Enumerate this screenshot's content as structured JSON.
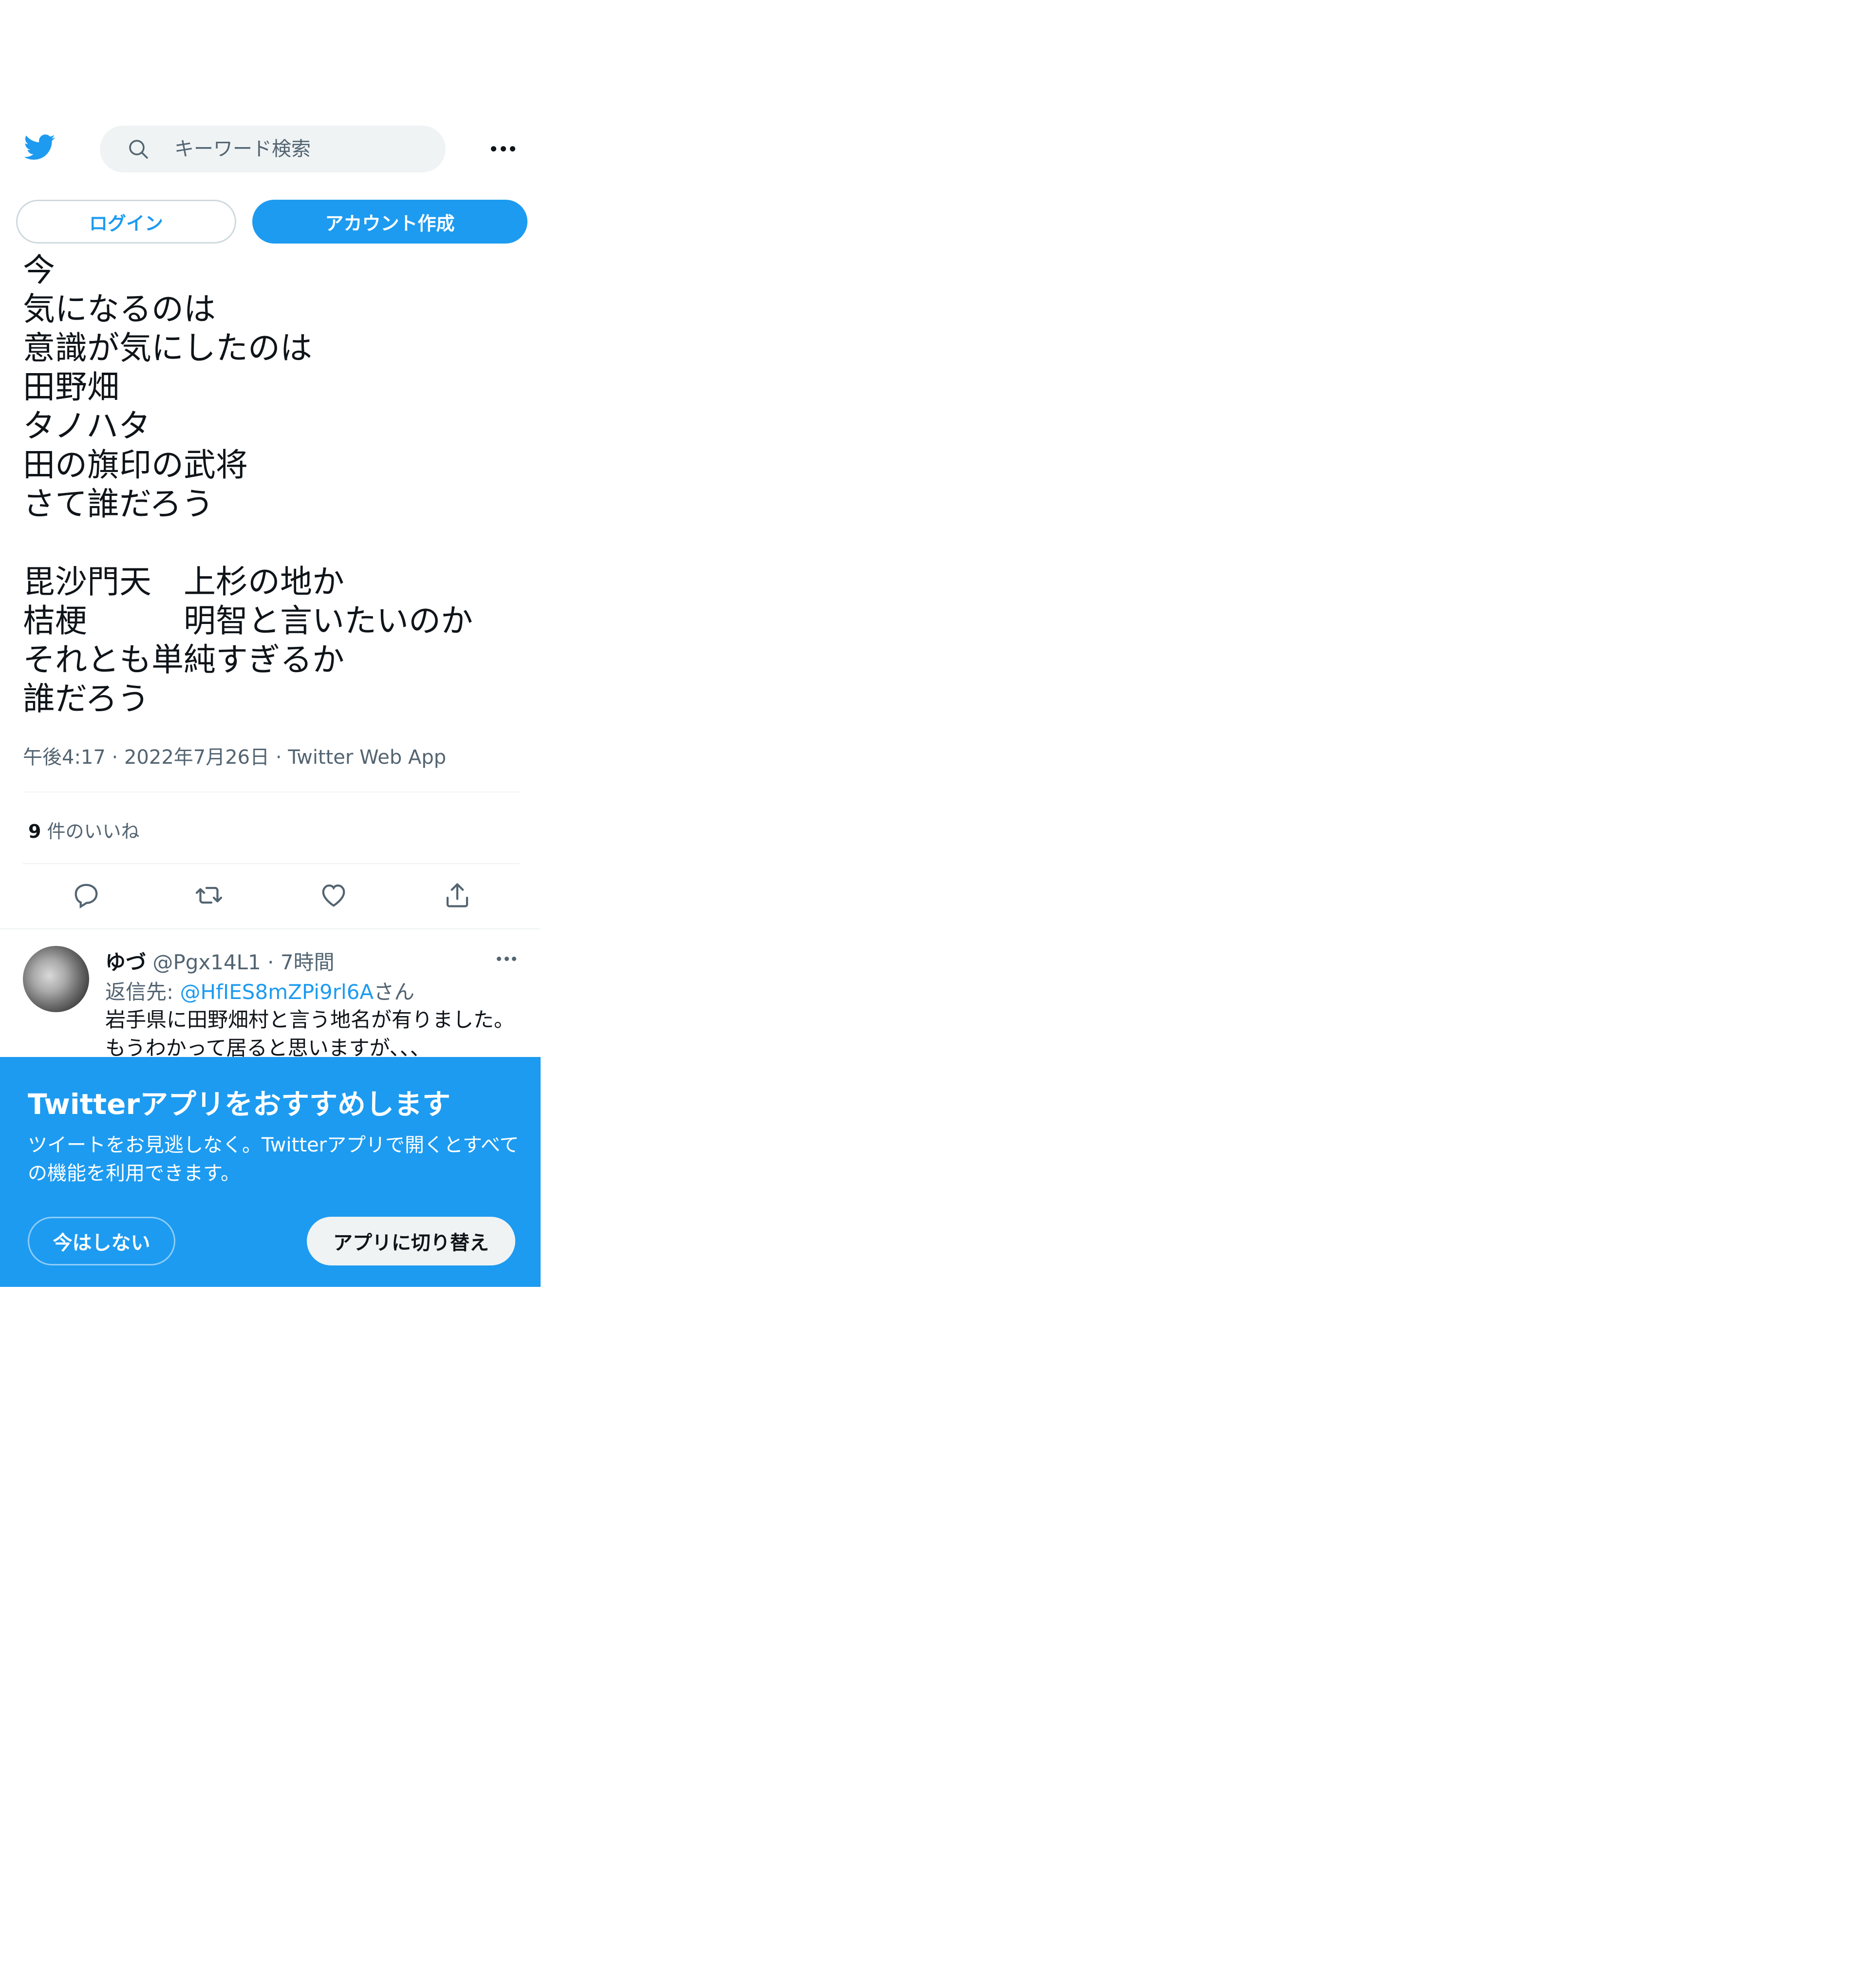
{
  "header": {
    "logo_icon": "twitter-bird-icon",
    "search": {
      "placeholder": "キーワード検索",
      "icon": "search-icon"
    },
    "more_icon": "more-horizontal-icon"
  },
  "auth": {
    "login_label": "ログイン",
    "signup_label": "アカウント作成"
  },
  "tweet": {
    "lines": [
      "今",
      "気になるのは",
      "意識が気にしたのは",
      "田野畑",
      "タノハタ",
      "田の旗印の武将",
      "さて誰だろう",
      "",
      "毘沙門天　上杉の地か",
      "桔梗　　　明智と言いたいのか",
      "それとも単純すぎるか",
      "誰だろう"
    ],
    "time": "午後4:17",
    "date": "2022年7月26日",
    "source": "Twitter Web App",
    "likes_count": "9",
    "likes_label": "件のいいね",
    "action_icons": [
      "reply-icon",
      "retweet-icon",
      "like-icon",
      "share-icon"
    ]
  },
  "reply": {
    "name": "ゆづ",
    "handle": "@Pgx14L1",
    "time": "7時間",
    "reply_to_prefix": "返信先: ",
    "reply_to_mention": "@HfIES8mZPi9rl6A",
    "reply_to_suffix": "さん",
    "text_line1": "岩手県に田野畑村と言う地名が有りました。",
    "text_line2": "もうわかって居ると思いますが、、、"
  },
  "app_promo": {
    "title": "Twitterアプリをおすすめします",
    "body": "ツイートをお見逃しなく。Twitterアプリで開くとすべての機能を利用できます。",
    "not_now_label": "今はしない",
    "switch_label": "アプリに切り替え"
  },
  "colors": {
    "accent": "#1d9bf0",
    "text": "#0f1419",
    "secondary": "#536471"
  }
}
